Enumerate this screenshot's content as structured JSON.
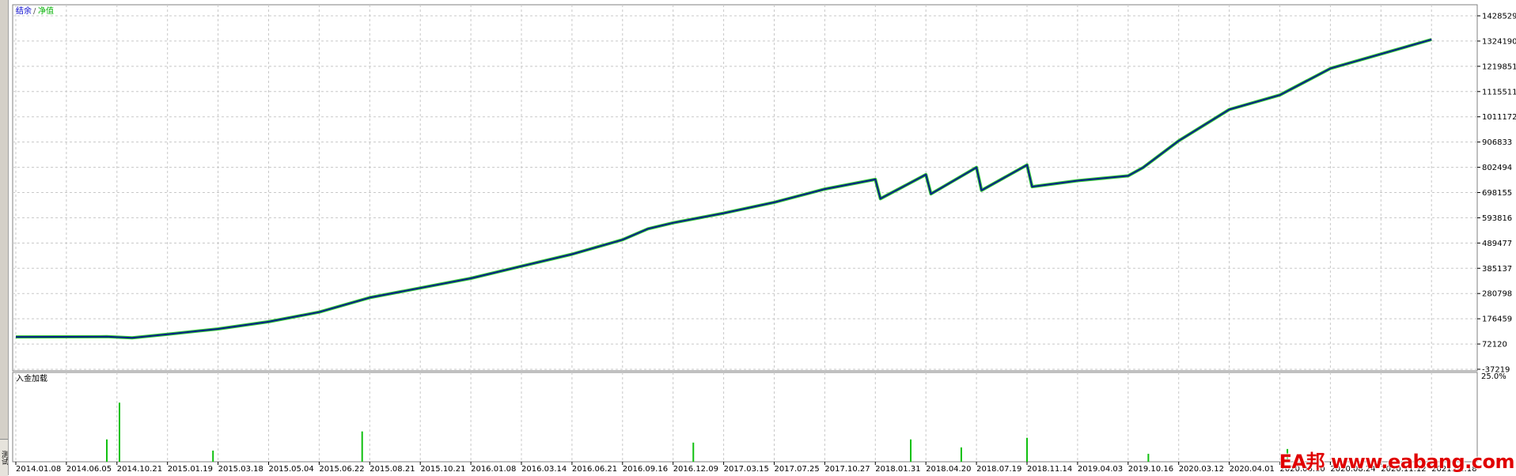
{
  "side_tab": {
    "label": "测试"
  },
  "legend": [
    {
      "label": "结余",
      "color": "#0000cd"
    },
    {
      "label": "净值",
      "color": "#00b000"
    }
  ],
  "lower_panel": {
    "label": "入金加载",
    "scale_label": "25.0%"
  },
  "watermark": "EA邦 www.eabang.com",
  "colors": {
    "balance": "#0a1f8a",
    "equity": "#10c010",
    "deposit_bars": "#10c010",
    "grid": "#c8c8c8"
  },
  "chart_data": {
    "type": "line",
    "title": "",
    "ylabel": "",
    "ylim": [
      -37219,
      1428529
    ],
    "y_ticks": [
      "1428529",
      "1324190",
      "1219851",
      "1115511",
      "1011172",
      "906833",
      "802494",
      "698155",
      "593816",
      "489477",
      "385137",
      "280798",
      "176459",
      "72120",
      "-37219"
    ],
    "x_ticks": [
      "2014.01.08",
      "2014.06.05",
      "2014.10.21",
      "2015.01.19",
      "2015.03.18",
      "2015.05.04",
      "2015.06.22",
      "2015.08.21",
      "2015.10.21",
      "2016.01.08",
      "2016.03.14",
      "2016.06.21",
      "2016.09.16",
      "2016.12.09",
      "2017.03.15",
      "2017.07.25",
      "2017.10.27",
      "2018.01.31",
      "2018.04.20",
      "2018.07.19",
      "2018.11.14",
      "2019.04.03",
      "2019.10.16",
      "2020.03.12",
      "2020.04.01",
      "2020.06.10",
      "2020.08.24",
      "2020.11.12",
      "2021.02.18"
    ],
    "series": [
      {
        "name": "结余",
        "x_index": [
          0,
          1.8,
          2.3,
          3,
          4,
          5,
          6,
          7,
          8,
          9,
          10,
          11,
          12,
          12.5,
          13,
          14,
          15,
          16,
          17,
          17.1,
          18,
          18.1,
          19,
          19.1,
          20,
          20.1,
          21,
          22,
          22.3,
          23,
          24,
          25,
          26,
          27,
          28
        ],
        "values": [
          97000,
          98000,
          93000,
          108000,
          130000,
          160000,
          200000,
          260000,
          300000,
          340000,
          390000,
          440000,
          500000,
          545000,
          570000,
          610000,
          655000,
          710000,
          750000,
          670000,
          770000,
          690000,
          800000,
          705000,
          810000,
          720000,
          745000,
          765000,
          800000,
          910000,
          1040000,
          1100000,
          1210000,
          1270000,
          1330000
        ]
      }
    ],
    "lower_panel": {
      "name": "入金加载",
      "ylim": [
        0,
        25.0
      ],
      "spikes": [
        {
          "x_index": 2.05,
          "value": 18.5
        },
        {
          "x_index": 1.8,
          "value": 7.0
        },
        {
          "x_index": 6.85,
          "value": 9.5
        },
        {
          "x_index": 17.7,
          "value": 7.0
        },
        {
          "x_index": 18.7,
          "value": 4.5
        },
        {
          "x_index": 20.0,
          "value": 7.5
        },
        {
          "x_index": 13.4,
          "value": 6.0
        },
        {
          "x_index": 25.15,
          "value": 4.0
        },
        {
          "x_index": 22.4,
          "value": 2.5
        },
        {
          "x_index": 3.9,
          "value": 3.5
        }
      ]
    }
  }
}
